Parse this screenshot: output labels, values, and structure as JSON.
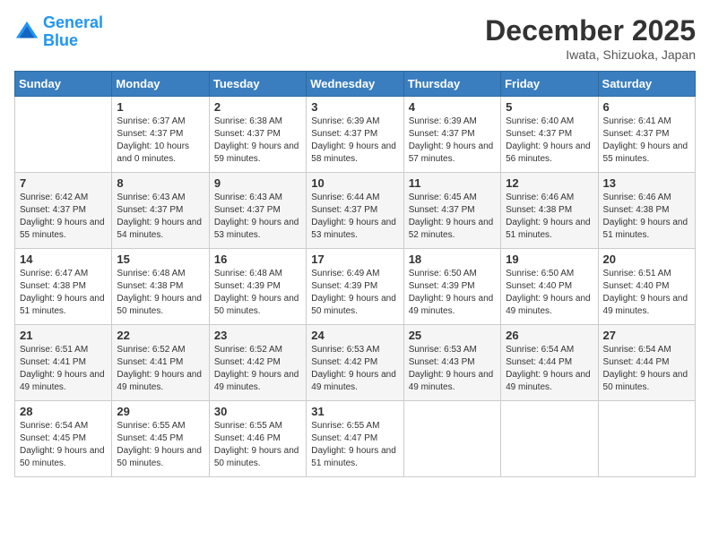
{
  "header": {
    "logo_line1": "General",
    "logo_line2": "Blue",
    "month_title": "December 2025",
    "location": "Iwata, Shizuoka, Japan"
  },
  "weekdays": [
    "Sunday",
    "Monday",
    "Tuesday",
    "Wednesday",
    "Thursday",
    "Friday",
    "Saturday"
  ],
  "weeks": [
    [
      {
        "day": "",
        "sunrise": "",
        "sunset": "",
        "daylight": ""
      },
      {
        "day": "1",
        "sunrise": "Sunrise: 6:37 AM",
        "sunset": "Sunset: 4:37 PM",
        "daylight": "Daylight: 10 hours and 0 minutes."
      },
      {
        "day": "2",
        "sunrise": "Sunrise: 6:38 AM",
        "sunset": "Sunset: 4:37 PM",
        "daylight": "Daylight: 9 hours and 59 minutes."
      },
      {
        "day": "3",
        "sunrise": "Sunrise: 6:39 AM",
        "sunset": "Sunset: 4:37 PM",
        "daylight": "Daylight: 9 hours and 58 minutes."
      },
      {
        "day": "4",
        "sunrise": "Sunrise: 6:39 AM",
        "sunset": "Sunset: 4:37 PM",
        "daylight": "Daylight: 9 hours and 57 minutes."
      },
      {
        "day": "5",
        "sunrise": "Sunrise: 6:40 AM",
        "sunset": "Sunset: 4:37 PM",
        "daylight": "Daylight: 9 hours and 56 minutes."
      },
      {
        "day": "6",
        "sunrise": "Sunrise: 6:41 AM",
        "sunset": "Sunset: 4:37 PM",
        "daylight": "Daylight: 9 hours and 55 minutes."
      }
    ],
    [
      {
        "day": "7",
        "sunrise": "Sunrise: 6:42 AM",
        "sunset": "Sunset: 4:37 PM",
        "daylight": "Daylight: 9 hours and 55 minutes."
      },
      {
        "day": "8",
        "sunrise": "Sunrise: 6:43 AM",
        "sunset": "Sunset: 4:37 PM",
        "daylight": "Daylight: 9 hours and 54 minutes."
      },
      {
        "day": "9",
        "sunrise": "Sunrise: 6:43 AM",
        "sunset": "Sunset: 4:37 PM",
        "daylight": "Daylight: 9 hours and 53 minutes."
      },
      {
        "day": "10",
        "sunrise": "Sunrise: 6:44 AM",
        "sunset": "Sunset: 4:37 PM",
        "daylight": "Daylight: 9 hours and 53 minutes."
      },
      {
        "day": "11",
        "sunrise": "Sunrise: 6:45 AM",
        "sunset": "Sunset: 4:37 PM",
        "daylight": "Daylight: 9 hours and 52 minutes."
      },
      {
        "day": "12",
        "sunrise": "Sunrise: 6:46 AM",
        "sunset": "Sunset: 4:38 PM",
        "daylight": "Daylight: 9 hours and 51 minutes."
      },
      {
        "day": "13",
        "sunrise": "Sunrise: 6:46 AM",
        "sunset": "Sunset: 4:38 PM",
        "daylight": "Daylight: 9 hours and 51 minutes."
      }
    ],
    [
      {
        "day": "14",
        "sunrise": "Sunrise: 6:47 AM",
        "sunset": "Sunset: 4:38 PM",
        "daylight": "Daylight: 9 hours and 51 minutes."
      },
      {
        "day": "15",
        "sunrise": "Sunrise: 6:48 AM",
        "sunset": "Sunset: 4:38 PM",
        "daylight": "Daylight: 9 hours and 50 minutes."
      },
      {
        "day": "16",
        "sunrise": "Sunrise: 6:48 AM",
        "sunset": "Sunset: 4:39 PM",
        "daylight": "Daylight: 9 hours and 50 minutes."
      },
      {
        "day": "17",
        "sunrise": "Sunrise: 6:49 AM",
        "sunset": "Sunset: 4:39 PM",
        "daylight": "Daylight: 9 hours and 50 minutes."
      },
      {
        "day": "18",
        "sunrise": "Sunrise: 6:50 AM",
        "sunset": "Sunset: 4:39 PM",
        "daylight": "Daylight: 9 hours and 49 minutes."
      },
      {
        "day": "19",
        "sunrise": "Sunrise: 6:50 AM",
        "sunset": "Sunset: 4:40 PM",
        "daylight": "Daylight: 9 hours and 49 minutes."
      },
      {
        "day": "20",
        "sunrise": "Sunrise: 6:51 AM",
        "sunset": "Sunset: 4:40 PM",
        "daylight": "Daylight: 9 hours and 49 minutes."
      }
    ],
    [
      {
        "day": "21",
        "sunrise": "Sunrise: 6:51 AM",
        "sunset": "Sunset: 4:41 PM",
        "daylight": "Daylight: 9 hours and 49 minutes."
      },
      {
        "day": "22",
        "sunrise": "Sunrise: 6:52 AM",
        "sunset": "Sunset: 4:41 PM",
        "daylight": "Daylight: 9 hours and 49 minutes."
      },
      {
        "day": "23",
        "sunrise": "Sunrise: 6:52 AM",
        "sunset": "Sunset: 4:42 PM",
        "daylight": "Daylight: 9 hours and 49 minutes."
      },
      {
        "day": "24",
        "sunrise": "Sunrise: 6:53 AM",
        "sunset": "Sunset: 4:42 PM",
        "daylight": "Daylight: 9 hours and 49 minutes."
      },
      {
        "day": "25",
        "sunrise": "Sunrise: 6:53 AM",
        "sunset": "Sunset: 4:43 PM",
        "daylight": "Daylight: 9 hours and 49 minutes."
      },
      {
        "day": "26",
        "sunrise": "Sunrise: 6:54 AM",
        "sunset": "Sunset: 4:44 PM",
        "daylight": "Daylight: 9 hours and 49 minutes."
      },
      {
        "day": "27",
        "sunrise": "Sunrise: 6:54 AM",
        "sunset": "Sunset: 4:44 PM",
        "daylight": "Daylight: 9 hours and 50 minutes."
      }
    ],
    [
      {
        "day": "28",
        "sunrise": "Sunrise: 6:54 AM",
        "sunset": "Sunset: 4:45 PM",
        "daylight": "Daylight: 9 hours and 50 minutes."
      },
      {
        "day": "29",
        "sunrise": "Sunrise: 6:55 AM",
        "sunset": "Sunset: 4:45 PM",
        "daylight": "Daylight: 9 hours and 50 minutes."
      },
      {
        "day": "30",
        "sunrise": "Sunrise: 6:55 AM",
        "sunset": "Sunset: 4:46 PM",
        "daylight": "Daylight: 9 hours and 50 minutes."
      },
      {
        "day": "31",
        "sunrise": "Sunrise: 6:55 AM",
        "sunset": "Sunset: 4:47 PM",
        "daylight": "Daylight: 9 hours and 51 minutes."
      },
      {
        "day": "",
        "sunrise": "",
        "sunset": "",
        "daylight": ""
      },
      {
        "day": "",
        "sunrise": "",
        "sunset": "",
        "daylight": ""
      },
      {
        "day": "",
        "sunrise": "",
        "sunset": "",
        "daylight": ""
      }
    ]
  ]
}
